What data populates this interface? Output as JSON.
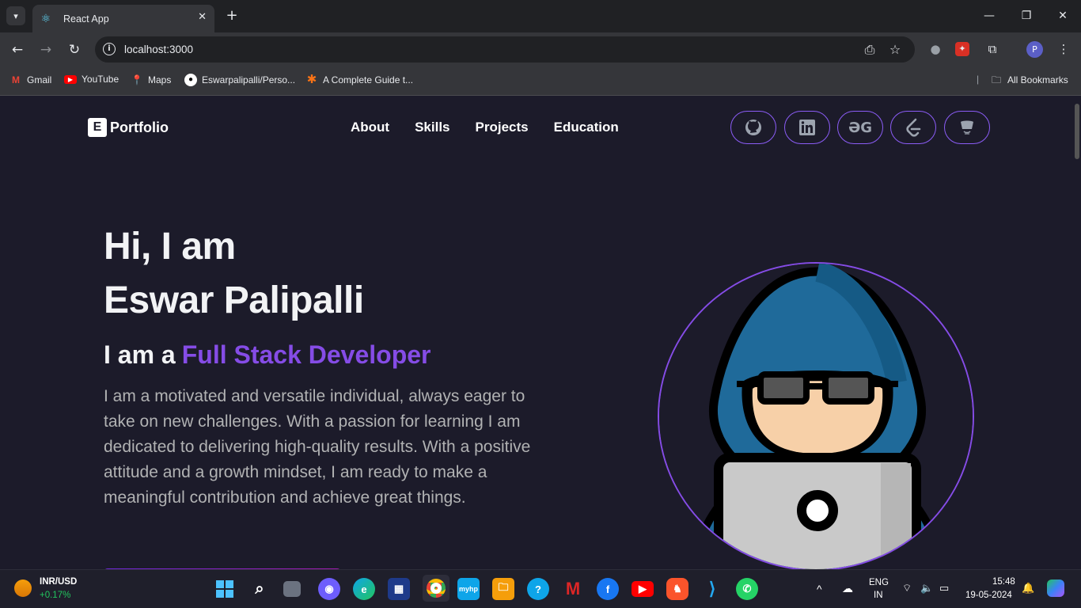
{
  "browser": {
    "tab_title": "React App",
    "url": "localhost:3000",
    "profile_initial": "P"
  },
  "bookmarks": [
    {
      "label": "Gmail",
      "icon": "gmail-icon",
      "color": "#ea4335"
    },
    {
      "label": "YouTube",
      "icon": "youtube-icon",
      "color": "#ff0000"
    },
    {
      "label": "Maps",
      "icon": "maps-icon",
      "color": "#34a853"
    },
    {
      "label": "Eswarpalipalli/Perso...",
      "icon": "github-icon",
      "color": "#ffffff"
    },
    {
      "label": "A Complete Guide t...",
      "icon": "asterisk-icon",
      "color": "#f97316"
    }
  ],
  "all_bookmarks_label": "All Bookmarks",
  "site": {
    "logo_letter": "E",
    "logo_text": "Portfolio",
    "nav": [
      "About",
      "Skills",
      "Projects",
      "Education"
    ],
    "social_icons": [
      "github-icon",
      "linkedin-icon",
      "geeksforgeeks-icon",
      "leetcode-icon",
      "codechef-icon"
    ],
    "hero": {
      "greeting": "Hi, I am",
      "name": "Eswar Palipalli",
      "role_prefix": "I am a",
      "role": "Full Stack Developer",
      "description": "I am a motivated and versatile individual, always eager to take on new challenges. With a passion for learning I am dedicated to delivering high-quality results. With a positive attitude and a growth mindset, I am ready to make a meaningful contribution and achieve great things."
    },
    "accent_color": "#854ce6"
  },
  "taskbar": {
    "widget_title": "INR/USD",
    "widget_value": "+0.17%",
    "lang_top": "ENG",
    "lang_bottom": "IN",
    "time": "15:48",
    "date": "19-05-2024"
  }
}
